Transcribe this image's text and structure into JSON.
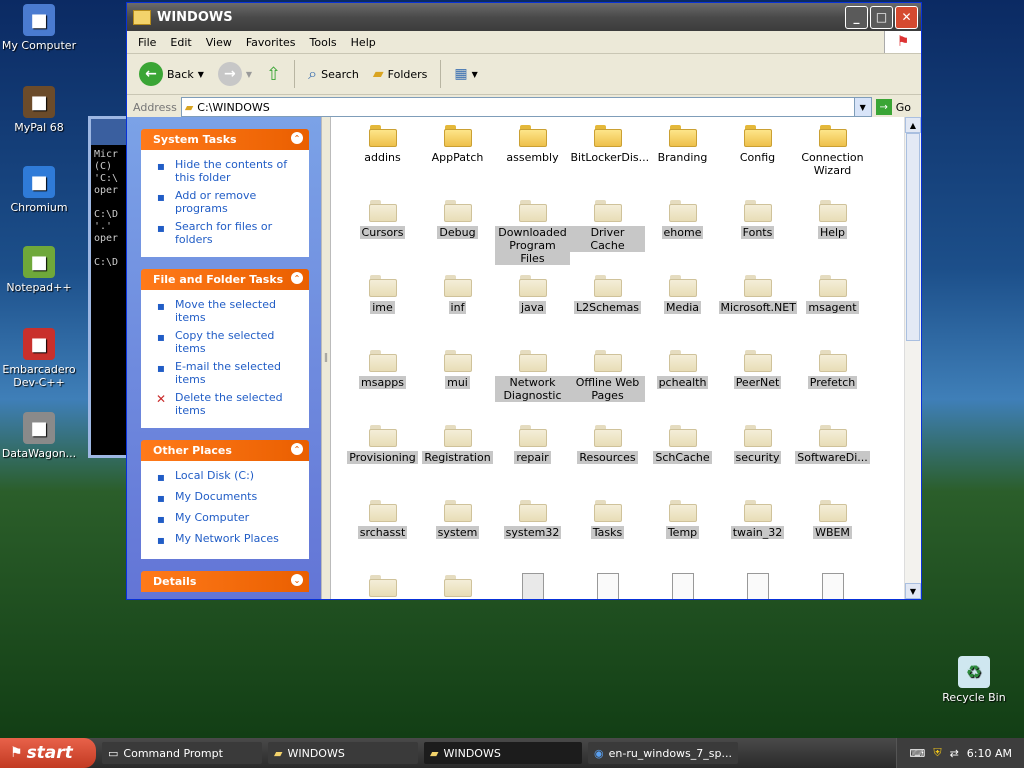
{
  "desktop": {
    "icons": [
      {
        "label": "My Computer",
        "icon": "my-computer-icon",
        "color": "#4a7bd0"
      },
      {
        "label": "MyPal 68",
        "icon": "mypal-icon",
        "color": "#6b4b2a"
      },
      {
        "label": "Chromium",
        "icon": "chromium-icon",
        "color": "#2f7bd8"
      },
      {
        "label": "Notepad++",
        "icon": "notepad-icon",
        "color": "#6fa83a"
      },
      {
        "label": "Embarcadero Dev-C++",
        "icon": "devcpp-icon",
        "color": "#c9302c"
      },
      {
        "label": "DataWagon...",
        "icon": "datawagon-icon",
        "color": "#8a8a8a"
      }
    ],
    "recycle_bin": "Recycle Bin"
  },
  "console": {
    "lines": [
      "Micr",
      "(C)",
      "'C:\\",
      "oper",
      "",
      "C:\\D",
      "'.'",
      "oper",
      "",
      "C:\\D"
    ]
  },
  "window": {
    "title": "WINDOWS",
    "menu": [
      "File",
      "Edit",
      "View",
      "Favorites",
      "Tools",
      "Help"
    ],
    "toolbar": {
      "back": "Back",
      "search": "Search",
      "folders": "Folders"
    },
    "address": {
      "label": "Address",
      "value": "C:\\WINDOWS",
      "go": "Go"
    }
  },
  "taskpane": {
    "system_tasks": {
      "title": "System Tasks",
      "items": [
        {
          "label": "Hide the contents of this folder",
          "icon": "hide-icon"
        },
        {
          "label": "Add or remove programs",
          "icon": "add-remove-icon"
        },
        {
          "label": "Search for files or folders",
          "icon": "search-icon"
        }
      ]
    },
    "file_tasks": {
      "title": "File and Folder Tasks",
      "items": [
        {
          "label": "Move the selected items",
          "icon": "move-icon"
        },
        {
          "label": "Copy the selected items",
          "icon": "copy-icon"
        },
        {
          "label": "E-mail the selected items",
          "icon": "email-icon"
        },
        {
          "label": "Delete the selected items",
          "icon": "delete-icon"
        }
      ]
    },
    "other_places": {
      "title": "Other Places",
      "items": [
        {
          "label": "Local Disk (C:)",
          "icon": "disk-icon"
        },
        {
          "label": "My Documents",
          "icon": "documents-icon"
        },
        {
          "label": "My Computer",
          "icon": "computer-icon"
        },
        {
          "label": "My Network Places",
          "icon": "network-icon"
        }
      ]
    },
    "details": {
      "title": "Details"
    }
  },
  "files": [
    {
      "name": "addins",
      "type": "folder",
      "selected": false
    },
    {
      "name": "AppPatch",
      "type": "folder",
      "selected": false
    },
    {
      "name": "assembly",
      "type": "folder",
      "selected": false
    },
    {
      "name": "BitLockerDis...",
      "type": "folder",
      "selected": false
    },
    {
      "name": "Branding",
      "type": "folder",
      "selected": false
    },
    {
      "name": "Config",
      "type": "folder",
      "selected": false
    },
    {
      "name": "Connection Wizard",
      "type": "folder",
      "selected": false
    },
    {
      "name": "Cursors",
      "type": "folder",
      "selected": true
    },
    {
      "name": "Debug",
      "type": "folder",
      "selected": true
    },
    {
      "name": "Downloaded Program Files",
      "type": "folder",
      "selected": true
    },
    {
      "name": "Driver Cache",
      "type": "folder",
      "selected": true
    },
    {
      "name": "ehome",
      "type": "folder",
      "selected": true
    },
    {
      "name": "Fonts",
      "type": "folder",
      "selected": true
    },
    {
      "name": "Help",
      "type": "folder",
      "selected": true
    },
    {
      "name": "ime",
      "type": "folder",
      "selected": true
    },
    {
      "name": "inf",
      "type": "folder",
      "selected": true
    },
    {
      "name": "java",
      "type": "folder",
      "selected": true
    },
    {
      "name": "L2Schemas",
      "type": "folder",
      "selected": true
    },
    {
      "name": "Media",
      "type": "folder",
      "selected": true
    },
    {
      "name": "Microsoft.NET",
      "type": "folder",
      "selected": true
    },
    {
      "name": "msagent",
      "type": "folder",
      "selected": true
    },
    {
      "name": "msapps",
      "type": "folder",
      "selected": true
    },
    {
      "name": "mui",
      "type": "folder",
      "selected": true
    },
    {
      "name": "Network Diagnostic",
      "type": "folder",
      "selected": true
    },
    {
      "name": "Offline Web Pages",
      "type": "folder",
      "selected": true
    },
    {
      "name": "pchealth",
      "type": "folder",
      "selected": true
    },
    {
      "name": "PeerNet",
      "type": "folder",
      "selected": true
    },
    {
      "name": "Prefetch",
      "type": "folder",
      "selected": true
    },
    {
      "name": "Provisioning",
      "type": "folder",
      "selected": true
    },
    {
      "name": "Registration",
      "type": "folder",
      "selected": true
    },
    {
      "name": "repair",
      "type": "folder",
      "selected": true
    },
    {
      "name": "Resources",
      "type": "folder",
      "selected": true
    },
    {
      "name": "SchCache",
      "type": "folder",
      "selected": true
    },
    {
      "name": "security",
      "type": "folder",
      "selected": true
    },
    {
      "name": "SoftwareDi...",
      "type": "folder",
      "selected": true
    },
    {
      "name": "srchasst",
      "type": "folder",
      "selected": true
    },
    {
      "name": "system",
      "type": "folder",
      "selected": true
    },
    {
      "name": "system32",
      "type": "folder",
      "selected": true
    },
    {
      "name": "Tasks",
      "type": "folder",
      "selected": true
    },
    {
      "name": "Temp",
      "type": "folder",
      "selected": true
    },
    {
      "name": "twain_32",
      "type": "folder",
      "selected": true
    },
    {
      "name": "WBEM",
      "type": "folder",
      "selected": true
    },
    {
      "name": "",
      "type": "folder",
      "selected": true
    },
    {
      "name": "",
      "type": "folder",
      "selected": true
    },
    {
      "name": "",
      "type": "msc",
      "selected": true
    },
    {
      "name": "",
      "type": "file",
      "selected": true
    },
    {
      "name": "",
      "type": "file",
      "selected": true
    },
    {
      "name": "",
      "type": "file",
      "selected": true
    },
    {
      "name": "",
      "type": "file",
      "selected": true
    }
  ],
  "taskbar": {
    "start": "start",
    "tasks": [
      {
        "label": "Command Prompt",
        "active": false
      },
      {
        "label": "WINDOWS",
        "active": false
      },
      {
        "label": "WINDOWS",
        "active": true
      },
      {
        "label": "en-ru_windows_7_sp...",
        "active": false
      }
    ],
    "clock": "6:10 AM"
  }
}
